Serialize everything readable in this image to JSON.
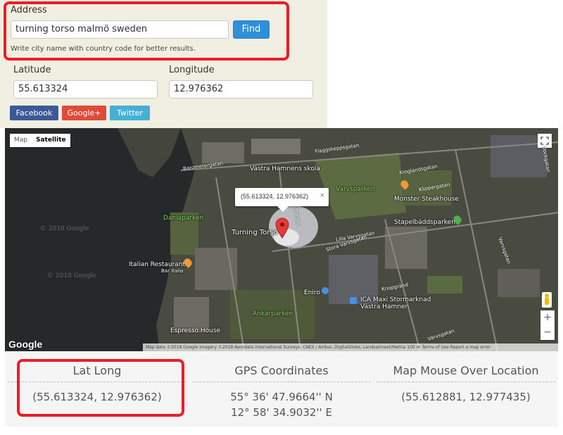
{
  "form": {
    "address_label": "Address",
    "address_value": "turning torso malmö sweden",
    "find_label": "Find",
    "hint": "Write city name with country code for better results.",
    "latitude_label": "Latitude",
    "latitude_value": "55.613324",
    "longitude_label": "Longitude",
    "longitude_value": "12.976362"
  },
  "social": {
    "facebook": "Facebook",
    "googleplus": "Google+",
    "twitter": "Twitter"
  },
  "map": {
    "type_map": "Map",
    "type_satellite": "Satellite",
    "infowindow": "(55.613324, 12.976362)",
    "infowindow_close": "×",
    "zoom_in": "+",
    "zoom_out": "−",
    "logo": "Google",
    "attribution": "Map data ©2018 Google Imagery ©2018 Aerodata International Surveys, CNES / Airbus, DigitalGlobe, Landsatmeet/Metria    100 m          Terms of Use    Report a map error",
    "watermark": "© 2018 Google",
    "labels": {
      "turning_torso": "Turning Torso",
      "vastra_hamnens_skola": "Västra Hamnens skola",
      "varvsparken": "Varvsparken",
      "monster_steakhouse": "Monster Steakhouse",
      "stapelbaddsparken": "Stapelbäddsparken",
      "daniaparken": "Daniaparken",
      "italian_restaurant": "Italian Restaurant",
      "bar_italia": "Bar Italia",
      "eniro": "Eniro",
      "ica": "ICA Maxi Stormarknad",
      "ica2": "Västra Hamnen",
      "ankarparken": "Ankarparken",
      "espresso_house": "Espresso House"
    },
    "streets": {
      "s1": "Flaggskeppsgatan",
      "s2": "Barometergatan",
      "s3": "Lilla Varvsgatan",
      "s4": "Stora Varvsgatan",
      "s5": "Masttorget",
      "s6": "Knopgränd",
      "s7": "Varvsgatan",
      "s8": "Kroglandsgatan",
      "s9": "Klippergatan",
      "s10": "Dockgatan",
      "s11": "Varvsgatan"
    },
    "colors": {
      "pin": "#e53935",
      "water": "#26292a",
      "land": "#4a4b40"
    }
  },
  "table": {
    "latlong_header": "Lat Long",
    "latlong_value": "(55.613324, 12.976362)",
    "gps_header": "GPS Coordinates",
    "gps_line1": "55° 36' 47.9664'' N",
    "gps_line2": "12° 58' 34.9032'' E",
    "mouse_header": "Map Mouse Over Location",
    "mouse_value": "(55.612881, 12.977435)"
  }
}
